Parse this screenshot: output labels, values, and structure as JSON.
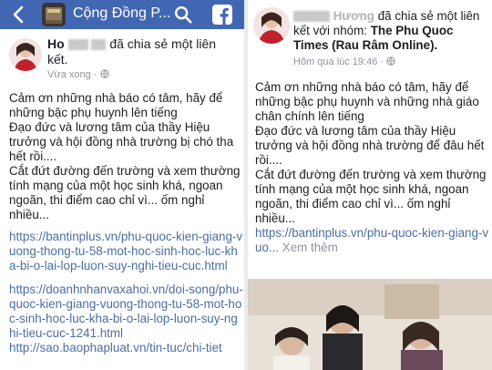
{
  "colors": {
    "topbar": "#4267b2",
    "link": "#4b6ea1",
    "meta": "#90949c",
    "text": "#1c1e21"
  },
  "left": {
    "topbar": {
      "group_name": "Cộng Đồng P...",
      "icons": [
        "back-arrow-icon",
        "group-avatar",
        "search-icon",
        "facebook-icon"
      ]
    },
    "post": {
      "author_prefix": "Ho",
      "action_text": "đã chia sẻ một liên kết.",
      "time": "Vừa xong",
      "privacy_icon": "globe-icon",
      "body": [
        "Cảm ơn những nhà báo có tâm, hãy để những bậc phụ huynh lên tiếng",
        "Đạo đức và lương tâm của thầy Hiệu trưởng và hội đồng nhà trường bị chó tha hết rồi....",
        "Cắt đứt đường đến trường và xem thường tính mạng của một học sinh  khá, ngoan ngoãn, thi điểm cao chỉ vì... ốm nghỉ nhiều..."
      ],
      "links": [
        "https://bantinplus.vn/phu-quoc-kien-giang-vuong-thong-tu-58-mot-hoc-sinh-hoc-luc-kha-bi-o-lai-lop-luon-suy-nghi-tieu-cuc.html",
        "https://doanhnhanvaxahoi.vn/doi-song/phu-quoc-kien-giang-vuong-thong-tu-58-mot-hoc-sinh-hoc-luc-kha-bi-o-lai-lop-luon-suy-nghi-tieu-cuc-1241.html",
        "http://sao.baophapluat.vn/tin-tuc/chi-tiet"
      ]
    }
  },
  "right": {
    "post": {
      "author_suffix": "Hương",
      "action_text": "đã chia sẻ một liên kết với nhóm:",
      "group": "The Phu Quoc Times (Rau Râm Online).",
      "time": "Hôm qua lúc 19:46",
      "privacy_icon": "globe-icon",
      "body": [
        "Cảm ơn những nhà báo có tâm, hãy để những bậc phụ huynh và những nhà giáo chân chính lên tiếng",
        "Đạo đức và lương tâm của thầy Hiệu trưởng và hội đồng nhà trường để đâu hết rồi....",
        "Cắt đứt đường đến trường và xem thường tính mạng của một học sinh  khá, ngoan ngoãn, thi điểm cao chỉ vì... ốm nghỉ nhiều..."
      ],
      "link": "https://bantinplus.vn/phu-quoc-kien-giang-vuo...",
      "see_more": "Xem thêm"
    }
  }
}
